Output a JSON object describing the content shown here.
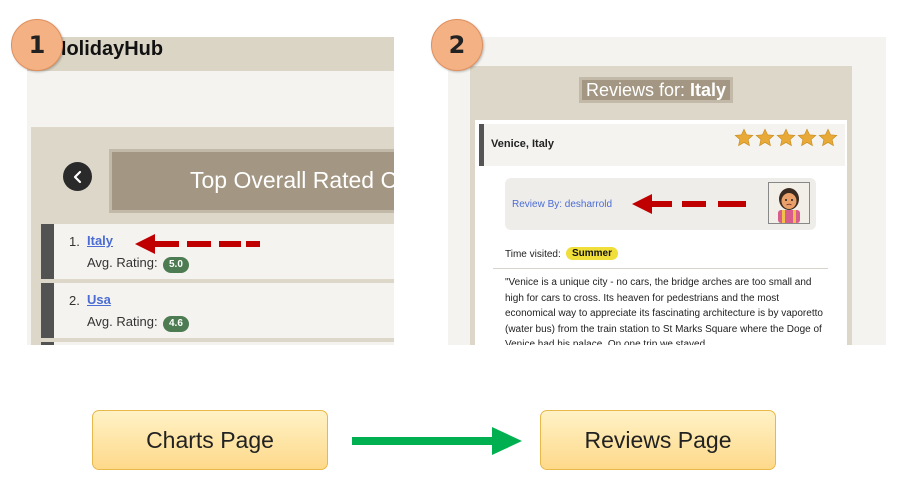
{
  "steps": [
    "1",
    "2"
  ],
  "panel1": {
    "app_title": "HolidayHub",
    "banner_title": "Top Overall Rated C",
    "rows": [
      {
        "rank": "1.",
        "name": "Italy",
        "avg_label": "Avg. Rating:",
        "rating": "5.0"
      },
      {
        "rank": "2.",
        "name": "Usa",
        "avg_label": "Avg. Rating:",
        "rating": "4.6"
      }
    ]
  },
  "panel2": {
    "title_prefix": "Reviews for:",
    "title_country": "Italy",
    "place": "Venice, Italy",
    "stars": 5,
    "review_by": "Review By: desharrold",
    "time_visited_label": "Time visited:",
    "season": "Summer",
    "review_text": "\"Venice is a unique city - no cars, the bridge arches are too small and high for cars to cross. Its heaven for pedestrians and the most economical way to appreciate its fascinating architecture is by vaporetto (water bus) from the train station to St Marks Square where the Doge of Venice had his palace. On one trip we stayed"
  },
  "flow": {
    "from_label": "Charts Page",
    "to_label": "Reviews Page"
  },
  "colors": {
    "badge": "#f4b183",
    "arrow_red": "#c00000",
    "arrow_green": "#00b050",
    "star": "#e8a937",
    "rating_pill": "#4d7c52"
  }
}
